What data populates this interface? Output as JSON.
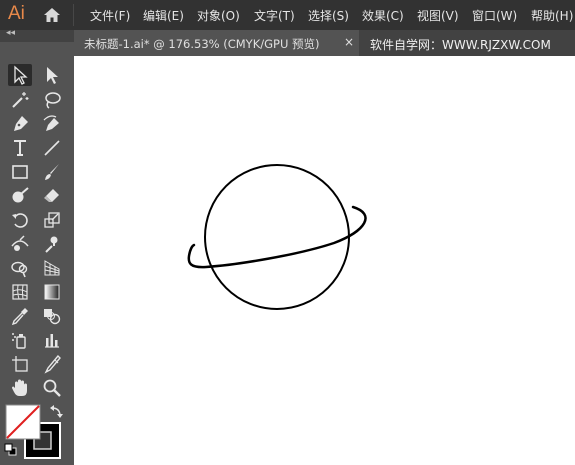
{
  "app": {
    "logo": "Ai",
    "home_icon": "home-icon"
  },
  "menu": [
    {
      "label": "文件(F)"
    },
    {
      "label": "编辑(E)"
    },
    {
      "label": "对象(O)"
    },
    {
      "label": "文字(T)"
    },
    {
      "label": "选择(S)"
    },
    {
      "label": "效果(C)"
    },
    {
      "label": "视图(V)"
    },
    {
      "label": "窗口(W)"
    },
    {
      "label": "帮助(H)"
    }
  ],
  "toolbar_collapse": "◂◂",
  "document_tab": {
    "title": "未标题-1.ai* @ 176.53% (CMYK/GPU 预览)",
    "close": "×"
  },
  "watermark": "软件自学网：WWW.RJZXW.COM",
  "tools": [
    {
      "name": "selection-tool-icon",
      "active": true
    },
    {
      "name": "direct-selection-tool-icon"
    },
    {
      "name": "magic-wand-tool-icon"
    },
    {
      "name": "lasso-tool-icon"
    },
    {
      "name": "pen-tool-icon"
    },
    {
      "name": "curvature-tool-icon"
    },
    {
      "name": "type-tool-icon"
    },
    {
      "name": "line-segment-tool-icon"
    },
    {
      "name": "rectangle-tool-icon"
    },
    {
      "name": "paintbrush-tool-icon"
    },
    {
      "name": "shaper-tool-icon"
    },
    {
      "name": "eraser-tool-icon"
    },
    {
      "name": "rotate-tool-icon"
    },
    {
      "name": "scale-tool-icon"
    },
    {
      "name": "width-tool-icon"
    },
    {
      "name": "puppet-warp-tool-icon"
    },
    {
      "name": "shape-builder-tool-icon"
    },
    {
      "name": "perspective-grid-tool-icon"
    },
    {
      "name": "mesh-tool-icon"
    },
    {
      "name": "gradient-tool-icon"
    },
    {
      "name": "eyedropper-tool-icon"
    },
    {
      "name": "blend-tool-icon"
    },
    {
      "name": "symbol-sprayer-tool-icon"
    },
    {
      "name": "column-graph-tool-icon"
    },
    {
      "name": "artboard-tool-icon"
    },
    {
      "name": "slice-tool-icon"
    },
    {
      "name": "hand-tool-icon"
    },
    {
      "name": "zoom-tool-icon"
    }
  ],
  "colors": {
    "fill": "none",
    "stroke": "#000000",
    "swap_icon": "swap-icon",
    "default_icon": "default-colors-icon"
  }
}
